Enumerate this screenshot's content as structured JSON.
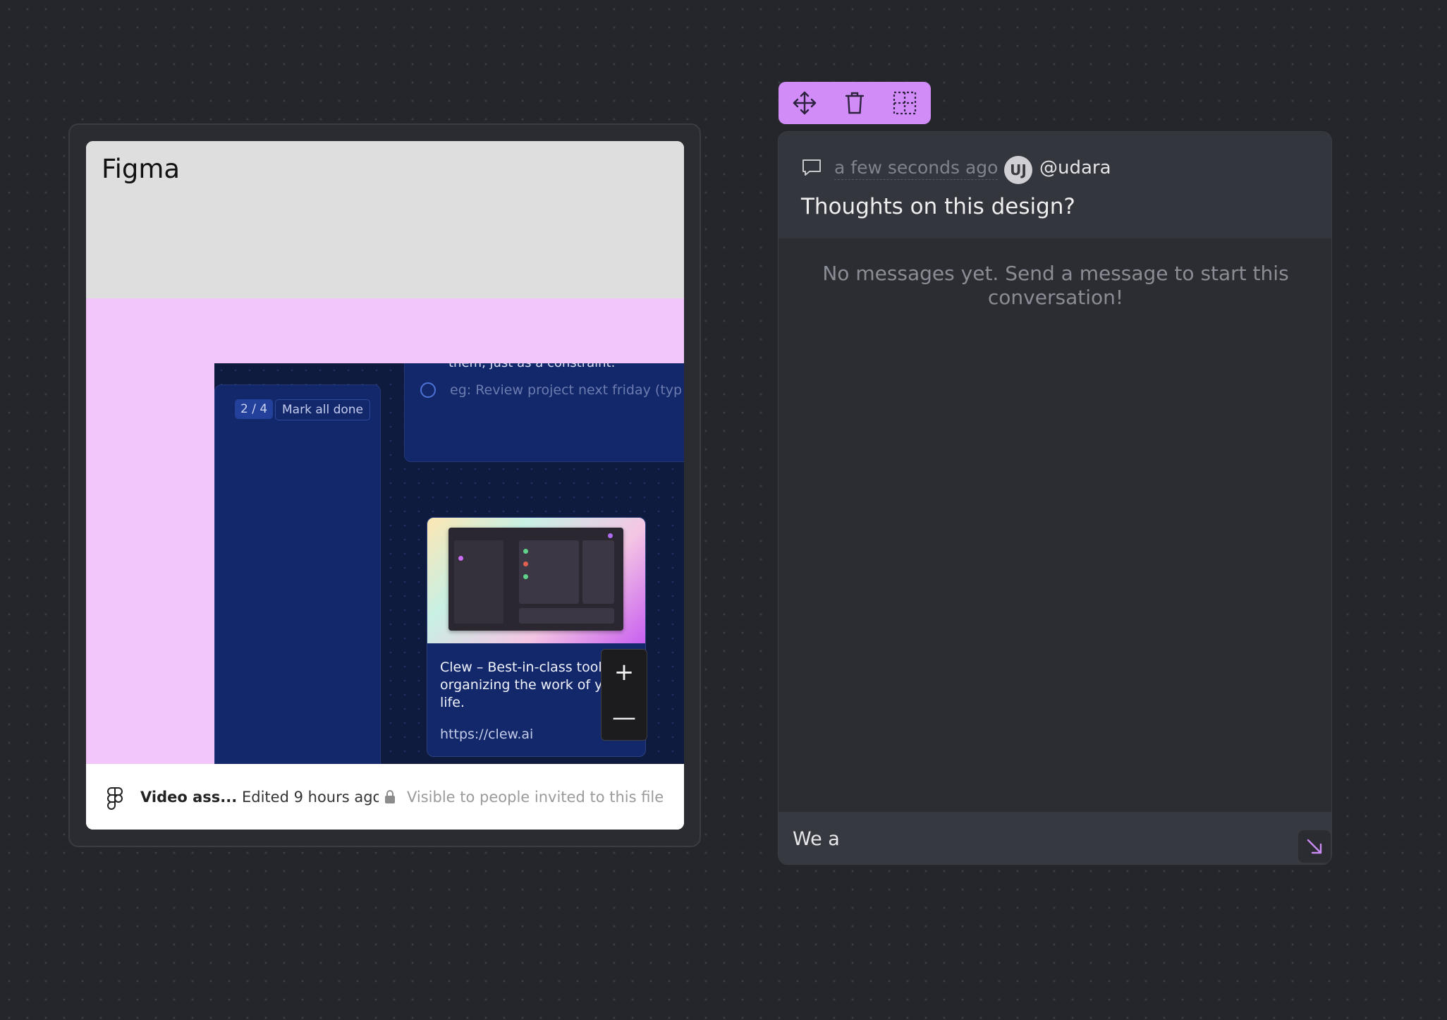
{
  "embed": {
    "title": "Figma",
    "app": {
      "clipped_text": "them, just as a constraint.",
      "task_placeholder": "eg: Review project next friday (typ",
      "count_badge": "2 / 4",
      "mark_all_done": "Mark all done",
      "link_card": {
        "title": "Clew – Best-in-class tool, for organizing the work of your life.",
        "url": "https://clew.ai"
      }
    },
    "zoom": {
      "plus": "+",
      "minus": "—"
    },
    "footer": {
      "file_name": "Video ass...",
      "edited": "Edited 9 hours ago",
      "visibility": "Visible to people invited to this file"
    }
  },
  "toolbar": {
    "icons": [
      "move-icon",
      "trash-icon",
      "select-frame-icon"
    ],
    "accent": "#d18cf7"
  },
  "thread": {
    "timestamp": "a few seconds ago",
    "avatar_initials": "UJ",
    "username": "@udara",
    "title": "Thoughts on this design?",
    "empty_message": "No messages yet. Send a message to start this conversation!",
    "composer_value": "We a"
  }
}
